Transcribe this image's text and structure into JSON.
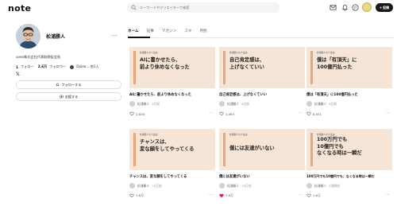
{
  "header": {
    "logo": "note",
    "search_placeholder": "キーワードやクリエイターで検索",
    "post_label": "投稿"
  },
  "profile": {
    "name": "松浦勝人",
    "bio": "avex株式会社代表取締役会長",
    "follow_count": "1",
    "follow_label": "フォロー",
    "follower_count": "2.6万",
    "follower_label": "フォロワー",
    "member_text": "Dalee... 他1人",
    "follow_button": "フォローする",
    "support_button": "支援する"
  },
  "tabs": [
    {
      "label": "ホーム",
      "active": true
    },
    {
      "label": "記事",
      "active": false
    },
    {
      "label": "マガジン",
      "active": false
    },
    {
      "label": "スキ",
      "active": false
    },
    {
      "label": "月別",
      "active": false
    }
  ],
  "cards": [
    {
      "eyebrow": "松浦勝人の人生論",
      "thumb_lines": [
        "AIに書かせたら、",
        "前より休めなくなった"
      ],
      "title": "AIに書かせたら、前より休めなくなった",
      "author": "松浦勝人",
      "ago": "4日前",
      "likes": "2,828",
      "liked": false
    },
    {
      "eyebrow": "松浦勝人の人生論",
      "thumb_lines": [
        "自己肯定感は、",
        "上げなくていい"
      ],
      "title": "自己肯定感は、上げなくていい",
      "author": "松浦勝人",
      "ago": "6日前",
      "likes": "3,063",
      "liked": false
    },
    {
      "eyebrow": "松浦勝人の人生論",
      "thumb_lines": [
        "僕は「有頂天」に",
        "100億円払った"
      ],
      "title": "僕は「有頂天」に100億円払った",
      "author": "松浦勝人",
      "ago": "8日前",
      "likes": "8,931",
      "liked": false
    },
    {
      "eyebrow": "松浦勝人の人生論",
      "thumb_lines": [
        "チャンスは、",
        "変な顔をしてやってくる"
      ],
      "title": "チャンスは、変な顔をしてやってくる",
      "author": "松浦勝人",
      "ago": "11日前",
      "likes": "1.6万",
      "liked": false
    },
    {
      "eyebrow": "松浦勝人の人生論",
      "thumb_lines": [
        "僕には友達がいない"
      ],
      "title": "僕には友達がいない",
      "author": "松浦勝人",
      "ago": "13日前",
      "likes": "1.6万",
      "liked": true
    },
    {
      "eyebrow": "松浦勝人の人生論",
      "thumb_lines": [
        "100万円でも",
        "10億円でも",
        "なくなる時は一瞬だ"
      ],
      "title": "100万円でも10億円でも、なくなる時は一瞬だ",
      "author": "松浦勝人",
      "ago": "2週間前",
      "likes": "1.6万",
      "liked": false
    }
  ],
  "colors": {
    "thumb_bg": "#f6e5d7",
    "thumb_bar": "#e6a87a",
    "liked_heart": "#e0245e",
    "post_button": "#1a1a1a"
  }
}
